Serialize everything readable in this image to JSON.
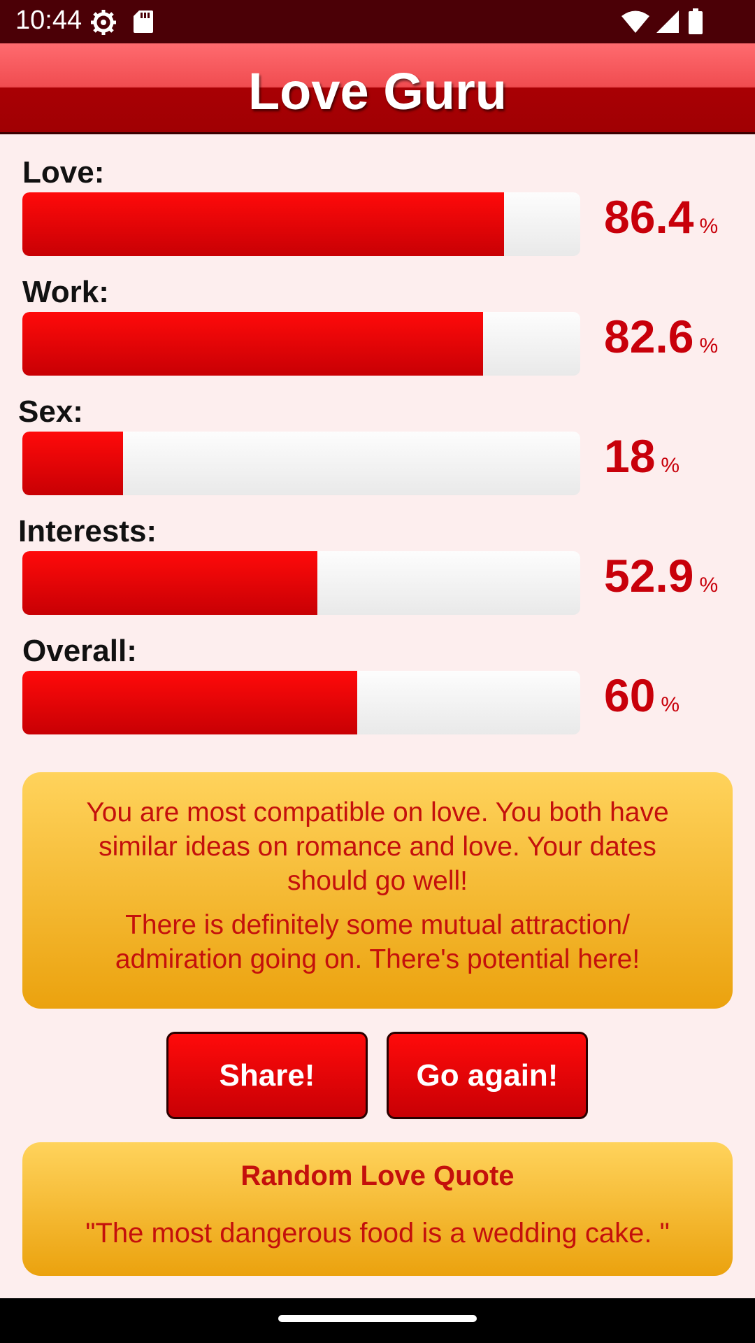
{
  "status_bar": {
    "time": "10:44",
    "icons": [
      "gear-icon",
      "sd-card-icon",
      "wifi-icon",
      "signal-icon",
      "battery-icon"
    ]
  },
  "header": {
    "title": "Love Guru"
  },
  "metrics": [
    {
      "label": "Love:",
      "value": "86.4",
      "unit": "%",
      "fill_fraction": 0.864
    },
    {
      "label": "Work:",
      "value": "82.6",
      "unit": "%",
      "fill_fraction": 0.826
    },
    {
      "label": "Sex:",
      "value": "18",
      "unit": "%",
      "fill_fraction": 0.18
    },
    {
      "label": "Interests:",
      "value": "52.9",
      "unit": "%",
      "fill_fraction": 0.529
    },
    {
      "label": "Overall:",
      "value": "60",
      "unit": "%",
      "fill_fraction": 0.6
    }
  ],
  "result": {
    "line1": "You are most compatible on love. You both have similar ideas on romance and love. Your dates should go well!",
    "line2": "There is definitely some mutual attraction/ admiration going on. There's potential here!"
  },
  "buttons": {
    "share": "Share!",
    "again": "Go again!"
  },
  "quote": {
    "title": "Random Love Quote",
    "text": "\"The most dangerous food is a wedding cake. \""
  },
  "colors": {
    "header": "#a00003",
    "bar_fill": "#e00008",
    "value_text": "#c8000a",
    "panel": "#f5b830",
    "background": "#fdeeee"
  }
}
